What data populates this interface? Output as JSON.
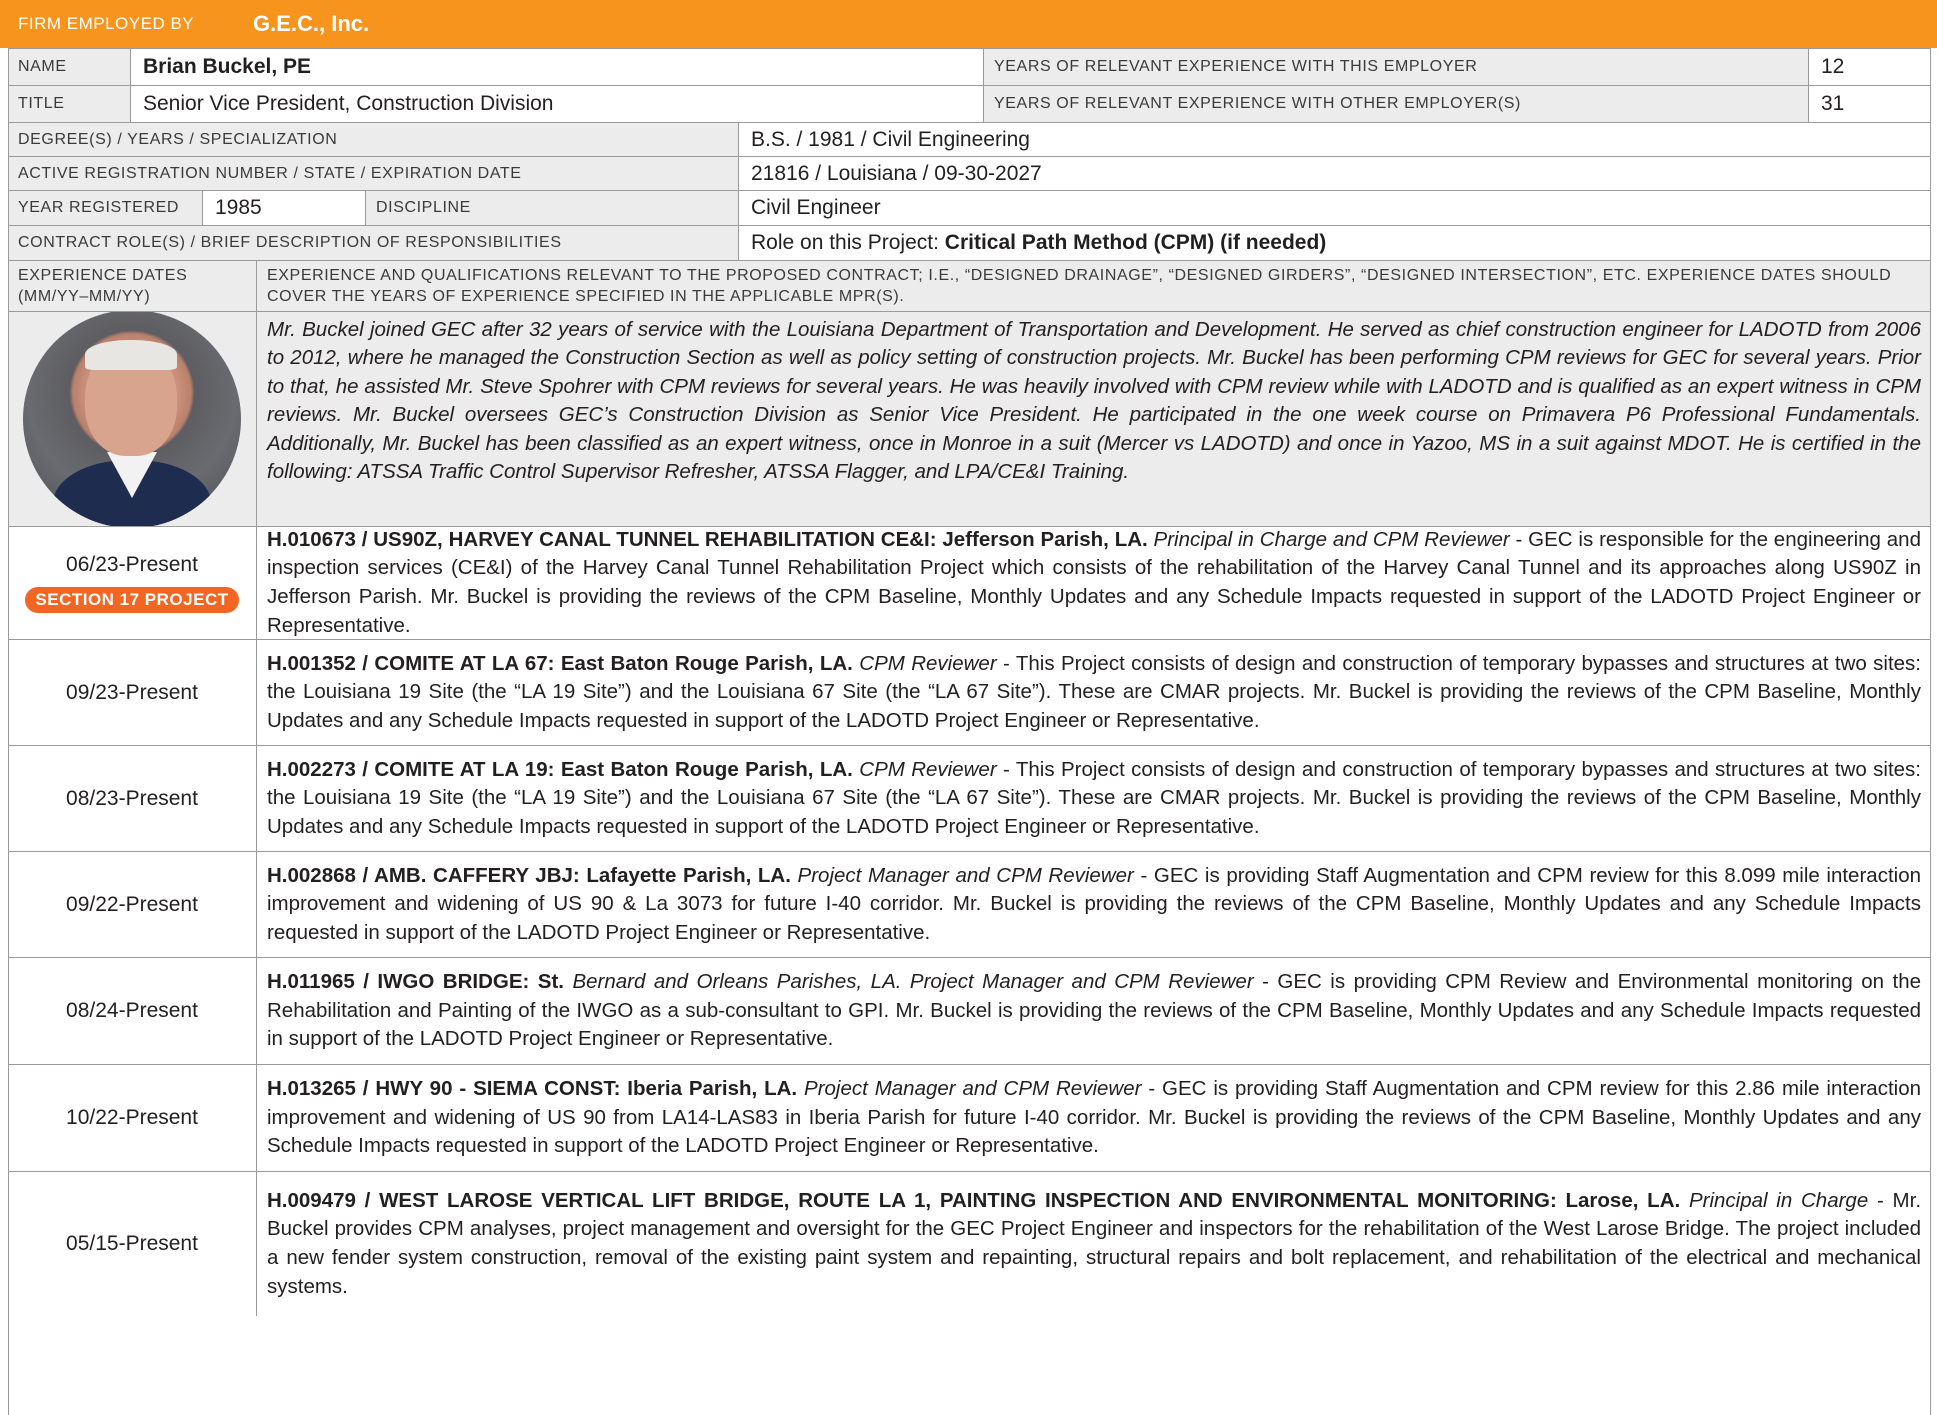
{
  "firm": {
    "label": "Firm Employed by",
    "value": "G.E.C., Inc."
  },
  "name": {
    "label": "Name",
    "value": "Brian Buckel, PE"
  },
  "title": {
    "label": "Title",
    "value": "Senior Vice President, Construction Division"
  },
  "years_this": {
    "label": "Years of Relevant Experience With This Employer",
    "value": "12"
  },
  "years_other": {
    "label": "Years of Relevant Experience With Other Employer(s)",
    "value": "31"
  },
  "degree": {
    "label": "Degree(s) / Years / Specialization",
    "value": "B.S. / 1981 / Civil Engineering"
  },
  "registration": {
    "label": "Active Registration Number / State / Expiration Date",
    "value": "21816 / Louisiana / 09-30-2027"
  },
  "year_registered": {
    "label": "Year Registered",
    "value": "1985"
  },
  "discipline": {
    "label": "Discipline",
    "value": "Civil Engineer"
  },
  "contract_role": {
    "label": "Contract Role(s) / Brief Description of Responsibilities",
    "prefix": "Role on this Project: ",
    "value": "Critical Path Method (CPM) (if needed)"
  },
  "experience_header": {
    "dates_label": "Experience Dates (MM/YY–MM/YY)",
    "desc_label": "Experience and Qualifications Relevant to the Proposed Contract; i.e., “Designed Drainage”, “Designed Girders”, “Designed Intersection”, etc.  Experience dates should cover the years of experience specified in the applicable MPR(s)."
  },
  "bio": "Mr. Buckel joined GEC after 32 years of service with the Louisiana Department of Transportation and Development. He served as chief construction engineer for LADOTD from 2006 to 2012, where he managed the Construction Section as well as policy setting of construction projects. Mr. Buckel has been performing CPM reviews for GEC for several years. Prior to that, he assisted Mr. Steve Spohrer with CPM reviews for several years. He was heavily involved with CPM review while with LADOTD and is qualified as an expert witness in CPM reviews. Mr. Buckel oversees GEC’s Construction Division as Senior Vice President. He participated in the one week course on Primavera P6 Professional Fundamentals. Additionally, Mr. Buckel has been classified as an expert witness, once in Monroe in a suit (Mercer vs LADOTD) and once in Yazoo, MS in a suit against MDOT.  He is certified in the following: ATSSA Traffic Control Supervisor Refresher, ATSSA Flagger, and LPA/CE&I Training.",
  "projects": [
    {
      "dates": "06/23-Present",
      "badge": "SECTION 17 PROJECT",
      "heading": "H.010673 / US90Z, HARVEY CANAL TUNNEL REHABILITATION CE&I: Jefferson Parish, LA.",
      "role": "Principal in Charge and CPM Reviewer",
      "body": " - GEC is responsible for the engineering and inspection services (CE&I) of the Harvey Canal Tunnel Rehabilitation Project which consists of the rehabilitation of the Harvey Canal Tunnel and its approaches along US90Z in Jefferson Parish. Mr. Buckel is providing the reviews of the CPM Baseline, Monthly Updates and any Schedule Impacts requested in support of the LADOTD Project Engineer or Representative."
    },
    {
      "dates": "09/23-Present",
      "heading": "H.001352 / COMITE AT LA 67: East Baton Rouge Parish, LA.",
      "role": "CPM Reviewer",
      "body": " - This Project consists of design and construction of temporary bypasses and structures at two sites: the Louisiana 19 Site (the “LA 19 Site”) and the Louisiana 67 Site (the “LA 67 Site”). These are CMAR projects. Mr. Buckel is providing the reviews of the CPM Baseline, Monthly Updates and any Schedule Impacts requested in support of the LADOTD Project Engineer or Representative."
    },
    {
      "dates": "08/23-Present",
      "heading": "H.002273 / COMITE AT LA 19: East Baton Rouge Parish, LA.",
      "role": "CPM Reviewer",
      "body": " - This Project consists of design and construction of temporary bypasses and structures at two sites: the Louisiana 19 Site (the “LA 19 Site”) and the Louisiana 67 Site (the “LA 67 Site”). These are CMAR projects. Mr. Buckel is providing the reviews of the CPM Baseline, Monthly Updates and any Schedule Impacts requested in support of the LADOTD Project Engineer or Representative."
    },
    {
      "dates": "09/22-Present",
      "heading": "H.002868 / AMB. CAFFERY JBJ: Lafayette Parish, LA.",
      "role": "Project Manager and CPM Reviewer",
      "body": " - GEC is providing Staff Augmentation and CPM review for this 8.099 mile interaction improvement and widening of US 90 & La 3073 for future I-40 corridor. Mr. Buckel is providing the reviews of the CPM Baseline, Monthly Updates and any Schedule Impacts requested in support of the LADOTD Project Engineer or Representative."
    },
    {
      "dates": "08/24-Present",
      "heading": "H.011965 / IWGO BRIDGE: St.",
      "role": "Bernard and Orleans Parishes, LA. Project Manager and CPM Reviewer",
      "body": " - GEC is providing CPM Review and Environmental monitoring on the Rehabilitation and Painting of the IWGO as a sub-consultant to GPI. Mr. Buckel is providing the reviews of the CPM Baseline, Monthly Updates and any Schedule Impacts requested in support of the LADOTD Project Engineer or Representative."
    },
    {
      "dates": "10/22-Present",
      "heading": "H.013265 / HWY 90 - SIEMA CONST: Iberia Parish, LA.",
      "role": "Project Manager and CPM Reviewer",
      "body": " - GEC is providing Staff Augmentation and CPM review for this 2.86 mile interaction improvement and widening of US 90 from LA14-LAS83 in Iberia Parish for future I-40 corridor. Mr. Buckel is providing the reviews of the CPM Baseline, Monthly Updates and any Schedule Impacts requested in support of the LADOTD Project Engineer or Representative."
    },
    {
      "dates": "05/15-Present",
      "heading": "H.009479 / WEST LAROSE VERTICAL LIFT BRIDGE, ROUTE LA 1, PAINTING INSPECTION AND ENVIRONMENTAL MONITORING: Larose, LA.",
      "role": "Principal in Charge",
      "body": " - Mr. Buckel provides CPM analyses, project management and oversight for the GEC Project Engineer and inspectors for the rehabilitation of the West Larose Bridge. The project included a new fender system construction, removal of the existing paint system and repainting, structural repairs and bolt replacement, and rehabilitation of the electrical and mechanical systems."
    }
  ],
  "colors": {
    "accent": "#f7941d",
    "badge": "#f26522",
    "label_bg": "#ececec",
    "border": "#9b9b9b"
  }
}
